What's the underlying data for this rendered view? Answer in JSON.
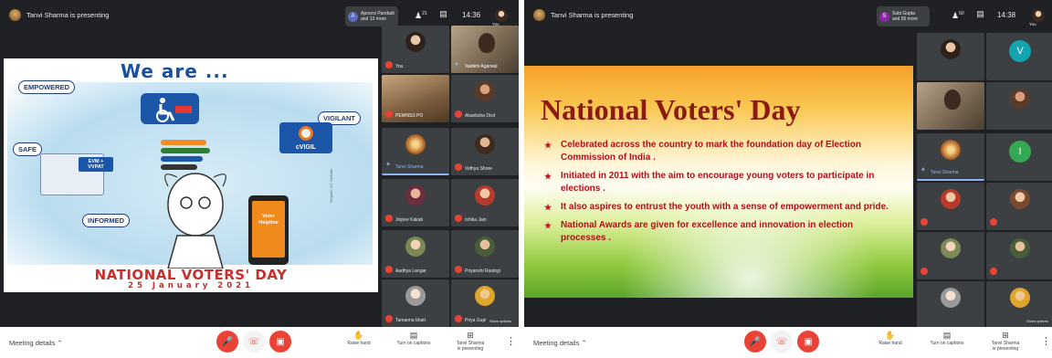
{
  "left": {
    "presenter": "Tanvi Sharma is presenting",
    "joined": {
      "initial": "A",
      "line1": "Apoorvi Pandadi",
      "line2": "and 13 more",
      "color": "#5c6bc0"
    },
    "people_count": "21",
    "clock": "14:36",
    "you_label": "You",
    "slide": {
      "heading": "We are ...",
      "labels": [
        "EMPOWERED",
        "VIGILANT",
        "SAFE",
        "INFORMED"
      ],
      "evm": "EVM + VVPAT",
      "vigil": "cVIGIL",
      "phone": "Voter Helpline",
      "credit": "Graphic: EC Website",
      "title": "NATIONAL VOTERS' DAY",
      "date": "25 January 2021"
    },
    "tiles": [
      {
        "name": "You"
      },
      {
        "name": "Vaidehi Agarwal"
      },
      {
        "name": "PEWNSS PO"
      },
      {
        "name": "Akanksha Dixit"
      },
      {
        "name": "Tanvi Sharma"
      },
      {
        "name": "Vidhya Shree"
      },
      {
        "name": "Jinjree Kakati"
      },
      {
        "name": "Ishika Jain"
      },
      {
        "name": "Aadhya Langar"
      },
      {
        "name": "Priyanshi Rastogi"
      },
      {
        "name": "Tamanna bhati"
      },
      {
        "name": "Priya Gupta"
      }
    ],
    "present_tag": "Show options",
    "bottom": {
      "meeting_details": "Meeting details",
      "raise_hand": "Raise hand",
      "captions": "Turn on captions",
      "presenting1": "Tanvi Sharma",
      "presenting2": "is presenting"
    }
  },
  "right": {
    "presenter": "Tanvi Sharma is presenting",
    "joined": {
      "initial": "S",
      "line1": "Subi Gupta",
      "line2": "and 56 more",
      "color": "#8e24aa"
    },
    "people_count": "60",
    "clock": "14:38",
    "you_label": "You",
    "slide": {
      "title": "National Voters' Day",
      "bullets": [
        "Celebrated across the  country to mark the foundation day of Election Commission of India .",
        "Initiated in 2011 with the aim to encourage young voters to participate in elections .",
        "It also aspires to entrust the youth with a sense of empowerment and pride.",
        "National Awards are given for excellence and innovation in election processes ."
      ]
    },
    "tiles": [
      {
        "name": ""
      },
      {
        "name": "",
        "letter": "V",
        "color": "#12a4af"
      },
      {
        "name": ""
      },
      {
        "name": ""
      },
      {
        "name": "Tanvi Sharma"
      },
      {
        "name": "",
        "letter": "I",
        "color": "#34a853"
      },
      {
        "name": ""
      },
      {
        "name": ""
      },
      {
        "name": ""
      },
      {
        "name": ""
      },
      {
        "name": ""
      },
      {
        "name": ""
      }
    ],
    "present_tag": "Show options",
    "bottom": {
      "meeting_details": "Meeting details",
      "raise_hand": "Raise hand",
      "captions": "Turn on captions",
      "presenting1": "Tanvi Sharma",
      "presenting2": "is presenting"
    }
  }
}
